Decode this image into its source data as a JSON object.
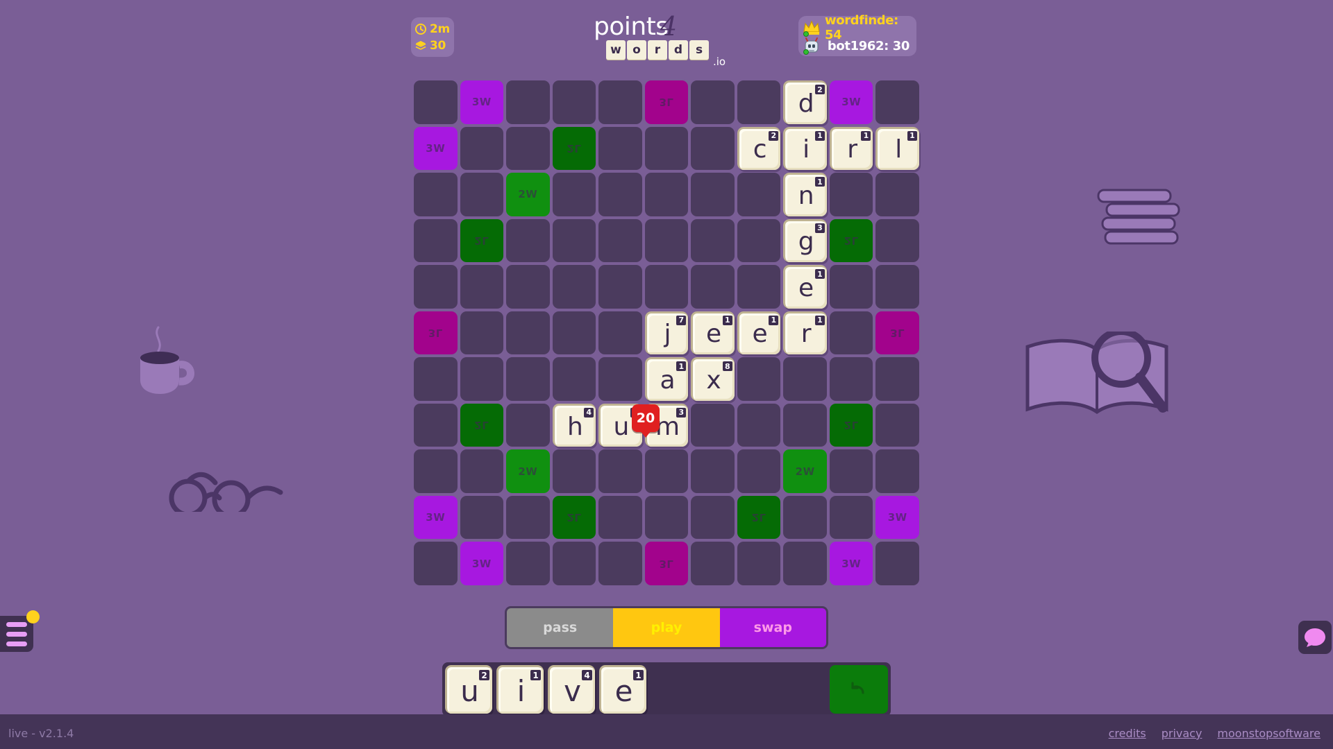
{
  "hud": {
    "timer_icon": "clock-icon",
    "timer_value": "2m",
    "tiles_icon": "tiles-stack-icon",
    "tiles_remaining": "30"
  },
  "logo": {
    "word": "points",
    "numeral": "4",
    "tiles": [
      "w",
      "o",
      "r",
      "d",
      "s"
    ],
    "tld": ".io"
  },
  "scoreboard": {
    "players": [
      {
        "icon": "crown-icon",
        "name_score": "wordfinde: 54",
        "status": "online",
        "leader": true
      },
      {
        "icon": "robot-icon",
        "name_score": "bot1962: 30",
        "status": "online",
        "leader": false
      }
    ]
  },
  "board": {
    "columns": 11,
    "rows": 11,
    "bonus_legend": {
      "2W": "double-word",
      "3W": "triple-word",
      "2L": "double-letter",
      "3L": "triple-letter"
    },
    "cells": [
      [
        {
          "b": ""
        },
        {
          "b": "3W"
        },
        {
          "b": ""
        },
        {
          "b": ""
        },
        {
          "b": ""
        },
        {
          "b": "3L"
        },
        {
          "b": ""
        },
        {
          "b": ""
        },
        {
          "b": "",
          "t": "d",
          "p": "2"
        },
        {
          "b": "3W"
        },
        {
          "b": ""
        }
      ],
      [
        {
          "b": "3W"
        },
        {
          "b": ""
        },
        {
          "b": ""
        },
        {
          "b": "2L"
        },
        {
          "b": ""
        },
        {
          "b": ""
        },
        {
          "b": ""
        },
        {
          "b": "",
          "t": "c",
          "p": "2"
        },
        {
          "b": "",
          "t": "i",
          "p": "1"
        },
        {
          "b": "",
          "t": "r",
          "p": "1"
        },
        {
          "b": "",
          "t": "l",
          "p": "1"
        }
      ],
      [
        {
          "b": ""
        },
        {
          "b": ""
        },
        {
          "b": "2W"
        },
        {
          "b": ""
        },
        {
          "b": ""
        },
        {
          "b": ""
        },
        {
          "b": ""
        },
        {
          "b": ""
        },
        {
          "b": "",
          "t": "n",
          "p": "1"
        },
        {
          "b": ""
        },
        {
          "b": ""
        }
      ],
      [
        {
          "b": ""
        },
        {
          "b": "2L"
        },
        {
          "b": ""
        },
        {
          "b": ""
        },
        {
          "b": ""
        },
        {
          "b": ""
        },
        {
          "b": ""
        },
        {
          "b": ""
        },
        {
          "b": "",
          "t": "g",
          "p": "3"
        },
        {
          "b": "2L"
        },
        {
          "b": ""
        }
      ],
      [
        {
          "b": ""
        },
        {
          "b": ""
        },
        {
          "b": ""
        },
        {
          "b": ""
        },
        {
          "b": ""
        },
        {
          "b": ""
        },
        {
          "b": ""
        },
        {
          "b": ""
        },
        {
          "b": "",
          "t": "e",
          "p": "1"
        },
        {
          "b": ""
        },
        {
          "b": ""
        }
      ],
      [
        {
          "b": "3L"
        },
        {
          "b": ""
        },
        {
          "b": ""
        },
        {
          "b": ""
        },
        {
          "b": ""
        },
        {
          "b": "",
          "t": "j",
          "p": "7"
        },
        {
          "b": "",
          "t": "e",
          "p": "1"
        },
        {
          "b": "",
          "t": "e",
          "p": "1"
        },
        {
          "b": "",
          "t": "r",
          "p": "1"
        },
        {
          "b": ""
        },
        {
          "b": "3L"
        }
      ],
      [
        {
          "b": ""
        },
        {
          "b": ""
        },
        {
          "b": ""
        },
        {
          "b": ""
        },
        {
          "b": ""
        },
        {
          "b": "",
          "t": "a",
          "p": "1"
        },
        {
          "b": "",
          "t": "x",
          "p": "8"
        },
        {
          "b": ""
        },
        {
          "b": ""
        },
        {
          "b": ""
        },
        {
          "b": ""
        }
      ],
      [
        {
          "b": ""
        },
        {
          "b": "2L"
        },
        {
          "b": ""
        },
        {
          "b": "",
          "t": "h",
          "p": "4"
        },
        {
          "b": "",
          "t": "u",
          "p": "2"
        },
        {
          "b": "",
          "t": "m",
          "p": "3"
        },
        {
          "b": ""
        },
        {
          "b": ""
        },
        {
          "b": ""
        },
        {
          "b": "2L"
        },
        {
          "b": ""
        }
      ],
      [
        {
          "b": ""
        },
        {
          "b": ""
        },
        {
          "b": "2W"
        },
        {
          "b": ""
        },
        {
          "b": ""
        },
        {
          "b": ""
        },
        {
          "b": ""
        },
        {
          "b": ""
        },
        {
          "b": "2W"
        },
        {
          "b": ""
        },
        {
          "b": ""
        }
      ],
      [
        {
          "b": "3W"
        },
        {
          "b": ""
        },
        {
          "b": ""
        },
        {
          "b": "2L"
        },
        {
          "b": ""
        },
        {
          "b": ""
        },
        {
          "b": ""
        },
        {
          "b": "2L"
        },
        {
          "b": ""
        },
        {
          "b": ""
        },
        {
          "b": "3W"
        }
      ],
      [
        {
          "b": ""
        },
        {
          "b": "3W"
        },
        {
          "b": ""
        },
        {
          "b": ""
        },
        {
          "b": ""
        },
        {
          "b": "3L"
        },
        {
          "b": ""
        },
        {
          "b": ""
        },
        {
          "b": ""
        },
        {
          "b": "3W"
        },
        {
          "b": ""
        }
      ]
    ]
  },
  "play_score": {
    "value": "20"
  },
  "actions": {
    "pass_label": "pass",
    "play_label": "play",
    "swap_label": "swap"
  },
  "rack": {
    "tiles": [
      {
        "letter": "u",
        "points": "2"
      },
      {
        "letter": "i",
        "points": "1"
      },
      {
        "letter": "v",
        "points": "4"
      },
      {
        "letter": "e",
        "points": "1"
      }
    ],
    "recall_icon": "undo-arrow-icon"
  },
  "chrome": {
    "version": "live - v2.1.4",
    "menu_icon": "hamburger-menu-icon",
    "chat_icon": "chat-bubble-icon",
    "footer_links": [
      "credits",
      "privacy",
      "moonstopsoftware"
    ]
  },
  "decorations": [
    "stacked-books-illustration",
    "open-book-magnifier-illustration",
    "coffee-mug-illustration",
    "eyeglasses-illustration"
  ],
  "colors": {
    "background": "#7a5e96",
    "cell": "#4b3b5e",
    "tile": "#f6f1dd",
    "double_word": "#109010",
    "triple_word": "#a718e0",
    "double_letter": "#056b05",
    "triple_letter": "#a2038c",
    "play_button": "#ffc710",
    "swap_button": "#a718e0",
    "score_bubble": "#e02020",
    "accent_yellow": "#ffd21e"
  }
}
